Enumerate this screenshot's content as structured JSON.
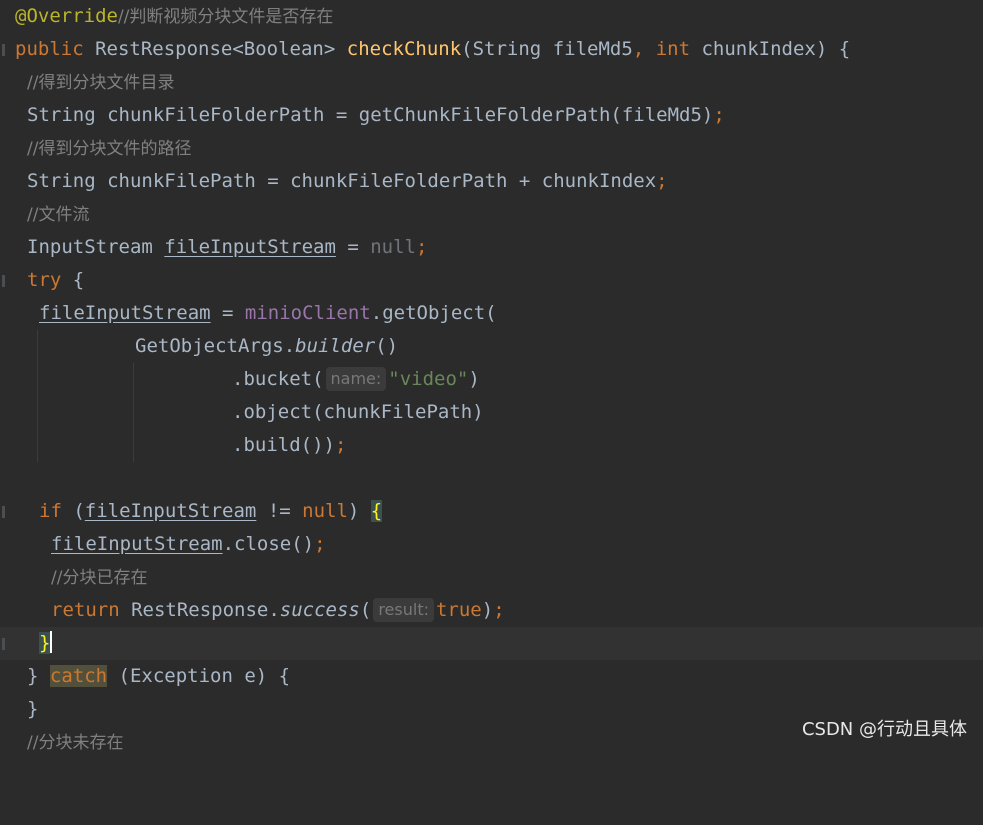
{
  "code": {
    "l1": {
      "annotation": "@Override",
      "comment": "//判断视频分块文件是否存在"
    },
    "l2": {
      "public": "public",
      "type": "RestResponse<Boolean>",
      "method": "checkChunk",
      "open": "(",
      "p1type": "String",
      "p1name": "fileMd5",
      "comma": ",",
      "int": "int",
      "p2name": "chunkIndex",
      "close": ") {"
    },
    "l3": {
      "comment": "//得到分块文件目录"
    },
    "l4": {
      "type": "String",
      "rest": "chunkFileFolderPath = getChunkFileFolderPath(fileMd5)",
      "semi": ";"
    },
    "l5": {
      "comment": "//得到分块文件的路径"
    },
    "l6": {
      "type": "String",
      "rest": "chunkFilePath = chunkFileFolderPath + chunkIndex",
      "semi": ";"
    },
    "l7": {
      "comment": "//文件流"
    },
    "l8": {
      "type": "InputStream",
      "var": "fileInputStream",
      "eq": " = ",
      "null": "null",
      "semi": ";"
    },
    "l9": {
      "try": "try",
      "brace": " {"
    },
    "l10": {
      "var": "fileInputStream",
      "eq": " = ",
      "field": "minioClient",
      "call": ".getObject("
    },
    "l11": {
      "cls": "GetObjectArgs.",
      "method": "builder",
      "rest": "()"
    },
    "l12": {
      "call": ".bucket(",
      "hint": "name:",
      "str": "\"video\"",
      "close": ")"
    },
    "l13": {
      "text": ".object(chunkFilePath)"
    },
    "l14": {
      "text": ".build())",
      "semi": ";"
    },
    "l16": {
      "if": "if",
      "open": " (",
      "var": "fileInputStream",
      "ne": " != ",
      "null": "null",
      "close": ") ",
      "brace": "{"
    },
    "l17": {
      "var": "fileInputStream",
      "rest": ".close()",
      "semi": ";"
    },
    "l18": {
      "comment": "//分块已存在"
    },
    "l19": {
      "return": "return",
      "cls": " RestResponse.",
      "method": "success",
      "open": "(",
      "hint": "result:",
      "val": "true",
      "close": ")",
      "semi": ";"
    },
    "l20": {
      "brace": "}"
    },
    "l21": {
      "close": "} ",
      "catch": "catch",
      "rest": " (Exception e) {"
    },
    "l22": {
      "brace": "}"
    },
    "l23": {
      "comment": "//分块未存在"
    }
  },
  "watermark": "CSDN @行动且具体"
}
